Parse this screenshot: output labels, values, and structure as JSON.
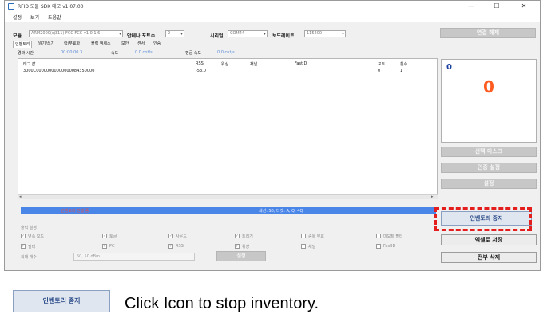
{
  "window": {
    "title": "RFID 모듈 SDK 데모 v1.07.00",
    "minimize": "—",
    "maximize": "☐",
    "close": "✕"
  },
  "menu": [
    "설정",
    "보기",
    "도움말"
  ],
  "connection": {
    "module_label": "모듈",
    "module_value": "ARM2000(sj311) FCC FCC v1.0.1.6",
    "antenna_label": "안테나 포트수",
    "antenna_value": "2",
    "serial_label": "시리얼",
    "serial_value": "COM44",
    "baud_label": "보드레이트",
    "baud_value": "115200",
    "disconnect_label": "연결 해제"
  },
  "tabs": [
    "인벤토리",
    "읽기/쓰기",
    "락/무효화",
    "블럭 액세스",
    "보안",
    "센서",
    "인증"
  ],
  "stats": {
    "elapsed_label": "경과 시간",
    "elapsed_value": "00:00:00.3",
    "speed_label": "속도",
    "speed_value": "0.0 cnt/s",
    "avg_speed_label": "평균 속도",
    "avg_speed_value": "0.0 cnt/s"
  },
  "table": {
    "columns": [
      "태그 값",
      "RSSI",
      "위상",
      "채널",
      "FastID",
      "포트",
      "횟수"
    ],
    "rows": [
      [
        "3000C00000000000000084350000",
        "-53.0",
        "",
        "",
        "",
        "0",
        "1"
      ]
    ]
  },
  "progress": {
    "left_text": "인벤토리 진행 중",
    "mid_text": "세션: S0, 타겟: A, Q: 4Q"
  },
  "options": {
    "section_label": "출력 설정",
    "items": [
      {
        "label": "연속 모드",
        "checked": true
      },
      {
        "label": "토글",
        "checked": true
      },
      {
        "label": "사운드",
        "checked": true
      },
      {
        "label": "트리거",
        "checked": true
      },
      {
        "label": "중복 무효",
        "checked": false
      },
      {
        "label": "미모트 필터",
        "checked": false
      },
      {
        "label": "필터",
        "checked": true
      },
      {
        "label": "PC",
        "checked": true
      },
      {
        "label": "RSSI",
        "checked": true
      },
      {
        "label": "위상",
        "checked": true
      },
      {
        "label": "채널",
        "checked": false
      },
      {
        "label": "FastID",
        "checked": false
      }
    ],
    "filter_label": "최대 개수",
    "filter_value": "50, 50 dBm",
    "settings_label": "설정"
  },
  "counter": {
    "small": "0",
    "big": "0"
  },
  "side_buttons": {
    "select_mask": "선택 마스크",
    "auth_settings": "인증 설정",
    "settings": "설정",
    "stop_inventory": "인벤토리 중지",
    "save_excel": "엑셀로 저장",
    "delete_all": "전부 삭제"
  },
  "example": {
    "button_label": "인벤토리 중지",
    "caption": "Click Icon to stop inventory."
  },
  "colors": {
    "progress": "#4a86e8",
    "highlight": "#e41d1d",
    "counter": "#ff5a1f"
  }
}
